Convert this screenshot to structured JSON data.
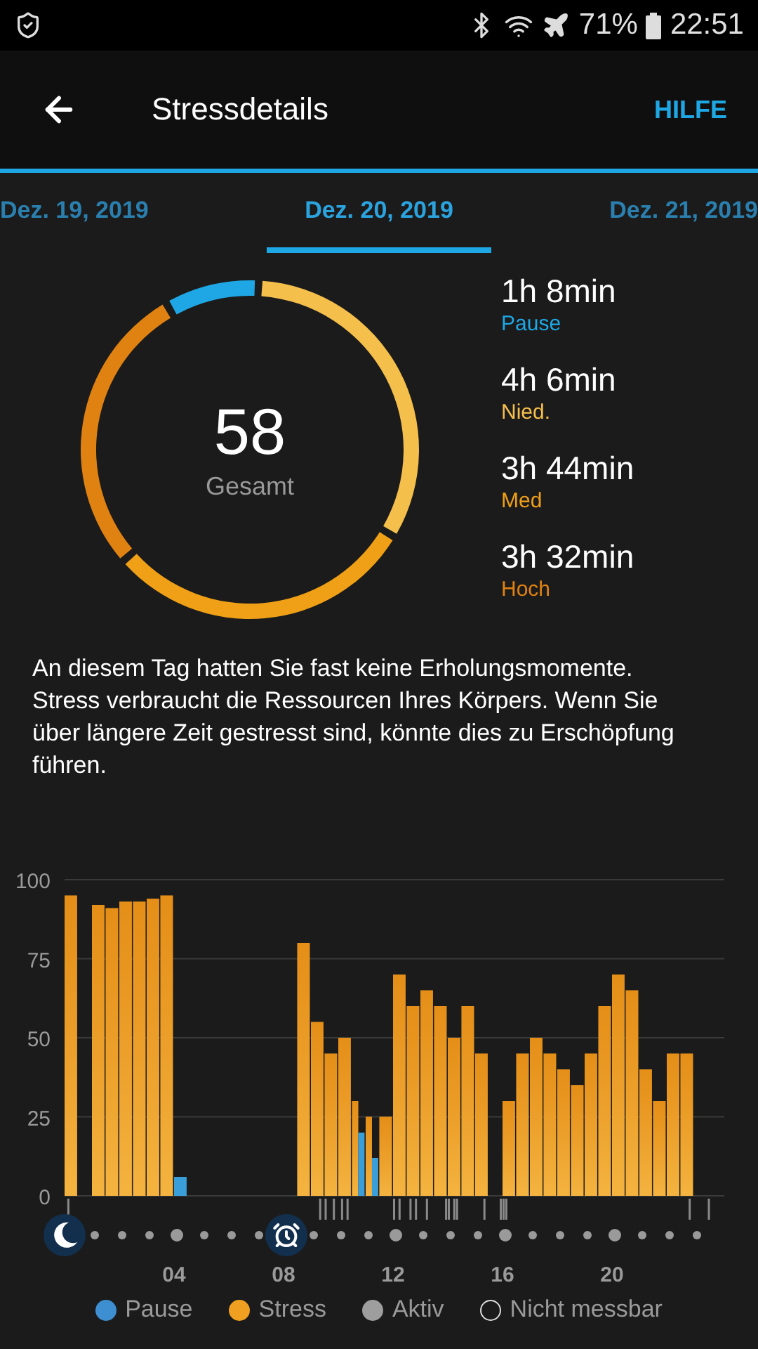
{
  "status_bar": {
    "battery": "71%",
    "time": "22:51"
  },
  "header": {
    "title": "Stressdetails",
    "action": "HILFE"
  },
  "date_tabs": [
    {
      "label": "Dez. 19, 2019",
      "selected": false
    },
    {
      "label": "Dez. 20, 2019",
      "selected": true
    },
    {
      "label": "Dez. 21, 2019",
      "selected": false
    }
  ],
  "summary": {
    "score": "58",
    "score_label": "Gesamt",
    "chart_data": {
      "type": "donut",
      "values": [
        9.1,
        32.8,
        29.9,
        28.2
      ]
    },
    "stats": [
      {
        "duration": "1h 8min",
        "label": "Pause",
        "color": "#1ea7e4"
      },
      {
        "duration": "4h 6min",
        "label": "Nied.",
        "color": "#f5bf4c"
      },
      {
        "duration": "3h 44min",
        "label": "Med",
        "color": "#efa016"
      },
      {
        "duration": "3h 32min",
        "label": "Hoch",
        "color": "#df8212"
      }
    ]
  },
  "message": "An diesem Tag hatten Sie fast keine Erholungsmomente. Stress verbraucht die Ressourcen Ihres Körpers. Wenn Sie über längere Zeit gestresst sind, könnte dies zu Erschöpfung führen.",
  "timeline": {
    "chart_data": {
      "type": "bar",
      "grid": true,
      "x": [
        0,
        0.5,
        1,
        1.5,
        2,
        2.5,
        3,
        3.5,
        4,
        4.5,
        5,
        5.5,
        6,
        6.5,
        7,
        7.5,
        8,
        8.5,
        9,
        9.5,
        10,
        10.5,
        11,
        11.5,
        12,
        12.5,
        13,
        13.5,
        14,
        14.5,
        15,
        15.5,
        16,
        16.5,
        17,
        17.5,
        18,
        18.5,
        19,
        19.5,
        20,
        20.5,
        21,
        21.5,
        22,
        22.5
      ],
      "series": [
        {
          "color": "#f0a020",
          "values": [
            95,
            null,
            92,
            91,
            93,
            93,
            94,
            95,
            null,
            null,
            null,
            null,
            null,
            null,
            null,
            null,
            null,
            80,
            55,
            45,
            50,
            30,
            25,
            25,
            70,
            60,
            65,
            60,
            50,
            60,
            45,
            null,
            30,
            45,
            50,
            45,
            40,
            35,
            45,
            60,
            70,
            65,
            40,
            30,
            45,
            45
          ]
        },
        {
          "color": "#3a9fd8",
          "values": [
            null,
            null,
            null,
            null,
            null,
            null,
            null,
            null,
            6,
            null,
            null,
            null,
            null,
            null,
            null,
            null,
            null,
            null,
            null,
            null,
            null,
            20,
            12,
            null,
            null,
            null,
            null,
            null,
            null,
            null,
            null,
            null,
            null,
            null,
            null,
            null,
            null,
            null,
            null,
            null,
            null,
            null,
            null,
            null,
            null,
            null
          ]
        }
      ],
      "xlim": [
        0,
        24
      ],
      "ylim": [
        0,
        100
      ],
      "yticks": [
        0,
        25,
        50,
        75,
        100
      ],
      "xticks": [
        {
          "value": 4,
          "label": "04"
        },
        {
          "value": 8,
          "label": "08"
        },
        {
          "value": 12,
          "label": "12"
        },
        {
          "value": 16,
          "label": "16"
        },
        {
          "value": 20,
          "label": "20"
        }
      ]
    }
  },
  "legend": [
    {
      "label": "Pause",
      "color": "#3d8fd1",
      "kind": "filled"
    },
    {
      "label": "Stress",
      "color": "#f0a020",
      "kind": "filled"
    },
    {
      "label": "Aktiv",
      "color": "#9e9e9e",
      "kind": "filled"
    },
    {
      "label": "Nicht messbar",
      "color": "#dddddd",
      "kind": "hollow"
    }
  ]
}
